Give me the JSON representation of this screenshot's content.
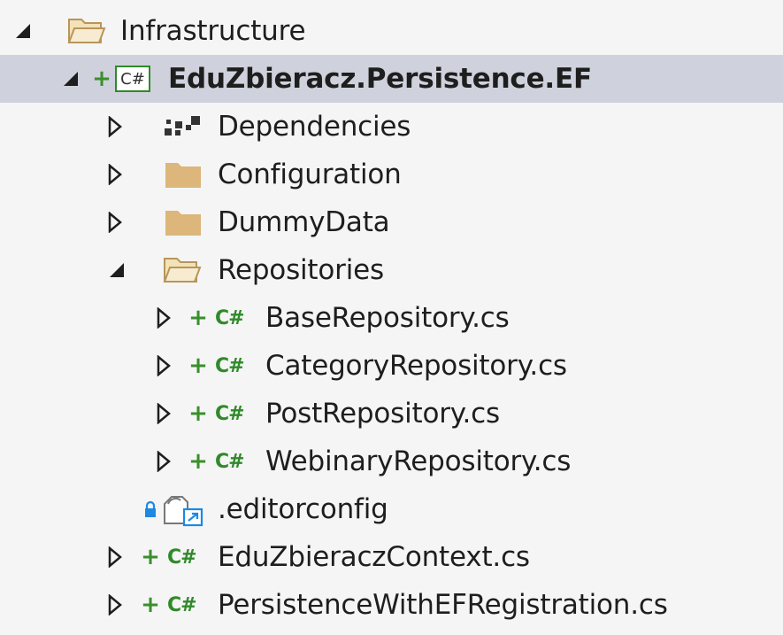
{
  "colors": {
    "background": "#f5f5f5",
    "selected_row": "#cfd2dc",
    "folder": "#dcb67a",
    "csharp": "#2f8a2a",
    "lock": "#1e88e5",
    "text": "#1e1e1e"
  },
  "tree": {
    "infrastructure": {
      "label": "Infrastructure",
      "icon": "folder-open-icon",
      "state": "expanded"
    },
    "project": {
      "label": "EduZbieracz.Persistence.EF",
      "cs_badge": "C#",
      "icon": "csharp-project-icon",
      "state": "expanded",
      "selected": true
    },
    "dependencies": {
      "label": "Dependencies",
      "icon": "dependencies-icon",
      "state": "collapsed"
    },
    "configuration": {
      "label": "Configuration",
      "icon": "folder-icon",
      "state": "collapsed"
    },
    "dummy_data": {
      "label": "DummyData",
      "icon": "folder-icon",
      "state": "collapsed"
    },
    "repositories": {
      "label": "Repositories",
      "icon": "folder-open-icon",
      "state": "expanded"
    },
    "repository_files": [
      {
        "label": "BaseRepository.cs",
        "cs": "C#"
      },
      {
        "label": "CategoryRepository.cs",
        "cs": "C#"
      },
      {
        "label": "PostRepository.cs",
        "cs": "C#"
      },
      {
        "label": "WebinaryRepository.cs",
        "cs": "C#"
      }
    ],
    "editorconfig": {
      "label": ".editorconfig",
      "icon": "editorconfig-icon"
    },
    "root_files": [
      {
        "label": "EduZbieraczContext.cs",
        "cs": "C#"
      },
      {
        "label": "PersistenceWithEFRegistration.cs",
        "cs": "C#"
      }
    ],
    "plus_glyph": "+"
  }
}
